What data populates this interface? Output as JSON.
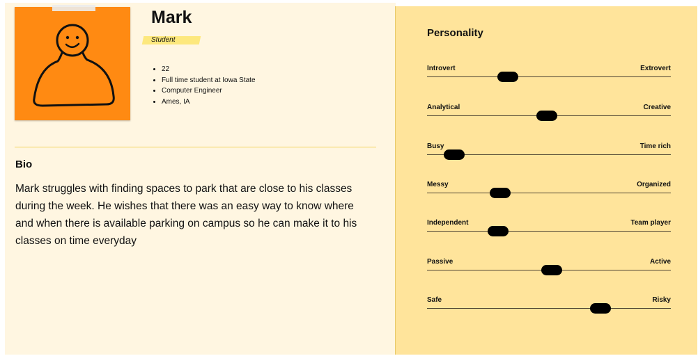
{
  "persona": {
    "name": "Mark",
    "role": "Student",
    "facts": [
      "22",
      "Full time student at Iowa State",
      "Computer Engineer",
      "Ames, IA"
    ]
  },
  "bio": {
    "heading": "Bio",
    "text": "Mark struggles with finding spaces to park that are close to his classes during the week. He wishes that there was an easy way to know where and when there is available parking on campus so he can make it to his classes on time everyday"
  },
  "personality": {
    "title": "Personality",
    "traits": [
      {
        "left": "Introvert",
        "right": "Extrovert",
        "value": 0.33
      },
      {
        "left": "Analytical",
        "right": "Creative",
        "value": 0.49
      },
      {
        "left": "Busy",
        "right": "Time rich",
        "value": 0.11
      },
      {
        "left": "Messy",
        "right": "Organized",
        "value": 0.3
      },
      {
        "left": "Independent",
        "right": "Team player",
        "value": 0.29
      },
      {
        "left": "Passive",
        "right": "Active",
        "value": 0.51
      },
      {
        "left": "Safe",
        "right": "Risky",
        "value": 0.71
      }
    ]
  },
  "icons": {
    "avatar": "person-doodle-icon"
  },
  "colors": {
    "avatar_bg": "#ff8a12",
    "left_bg": "#fff6e1",
    "right_bg": "#ffe49b",
    "badge": "#fde87d",
    "knob": "#000000"
  }
}
